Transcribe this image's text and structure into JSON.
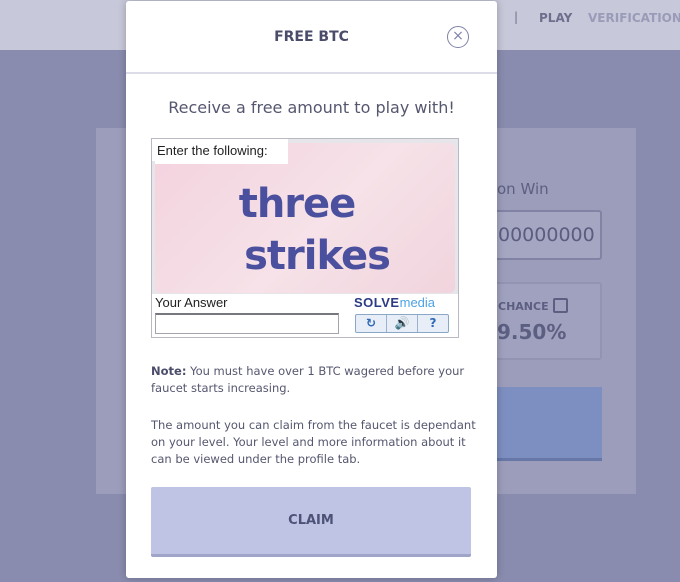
{
  "background": {
    "nav": {
      "separator": "|",
      "play": "PLAY",
      "verification": "VERIFICATION"
    },
    "win_label": "on Win",
    "win_value": "00000000",
    "chance_label": "CHANCE",
    "chance_value": "9.50%"
  },
  "modal": {
    "title": "FREE BTC",
    "close_icon": "×",
    "subtitle": "Receive a free amount to play with!",
    "captcha": {
      "prompt": "Enter the following:",
      "word1": "three",
      "word2": "strikes",
      "answer_label": "Your Answer",
      "answer_value": "",
      "brand_a": "SOLVE",
      "brand_b": "media",
      "tools": {
        "refresh": "↻",
        "audio": "🔊",
        "help": "?"
      }
    },
    "note_label": "Note:",
    "note_text": " You must have over 1 BTC wagered before your faucet starts increasing.",
    "info_text": "The amount you can claim from the faucet is dependant on your level. Your level and more information about it can be viewed under the profile tab.",
    "claim_label": "CLAIM"
  },
  "colors": {
    "overlay": "#8a8caf",
    "claim_button": "#bfc4e4",
    "captcha_text": "#4a4f9e",
    "brand_dark": "#2b3b84",
    "brand_light": "#4ea3e5"
  }
}
